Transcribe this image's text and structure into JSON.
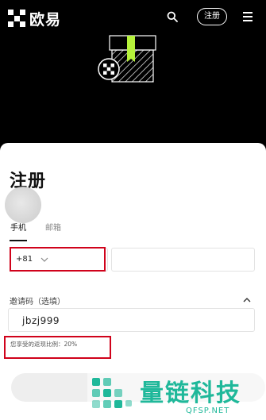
{
  "header": {
    "brand_name": "欧易",
    "register_label": "注册",
    "icons": {
      "search": "search-icon",
      "menu": "menu-icon",
      "logo": "okx-logo-icon"
    }
  },
  "form": {
    "title": "注册",
    "tabs": [
      {
        "label": "手机",
        "active": true
      },
      {
        "label": "邮箱",
        "active": false
      }
    ],
    "country_code": "+81",
    "phone_placeholder": "",
    "invite_label": "邀请码（选填）",
    "invite_value": "jbzj999",
    "rebate_text": "您享受的返现比例：20%"
  },
  "annotations": {
    "highlight_color": "#d0021b"
  },
  "watermark": {
    "name": "量链科技",
    "url": "QFSP.NET"
  },
  "colors": {
    "background": "#000000",
    "sheet": "#ffffff",
    "gift_accent": "#b6f23b",
    "watermark": "#1fb89a"
  }
}
